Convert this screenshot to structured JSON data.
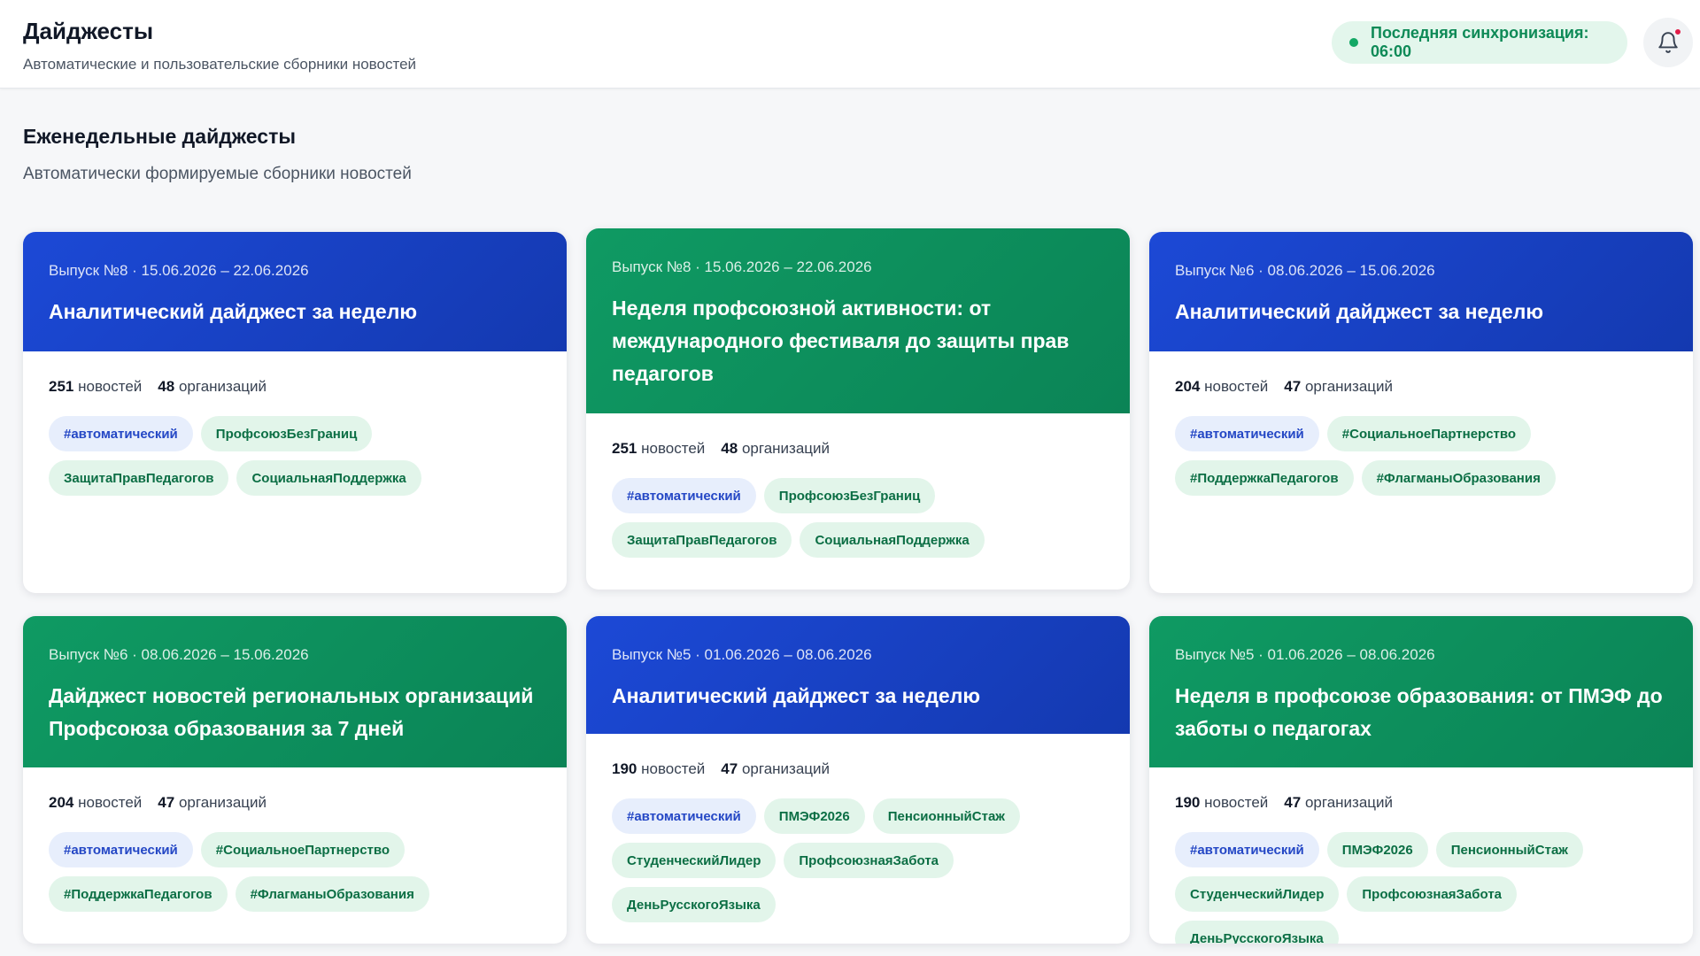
{
  "header": {
    "title": "Дайджесты",
    "subtitle": "Автоматические и пользовательские сборники новостей",
    "sync_status": "Последняя синхронизация: 06:00"
  },
  "section": {
    "title": "Еженедельные дайджесты",
    "subtitle": "Автоматически формируемые сборники новостей"
  },
  "labels": {
    "news": "новостей",
    "orgs": "организаций"
  },
  "colors": {
    "blue_header": "#1c49d6",
    "green_header": "#0f9a63",
    "sync_bg": "#e3f6ec",
    "sync_text": "#0e8a57",
    "tag_green_bg": "#e2f5ea",
    "tag_blue_bg": "#e7eefc",
    "notification_badge": "#e11d48"
  },
  "icons": {
    "sync": "status-dot-icon",
    "notifications": "bell-icon"
  },
  "cards": [
    {
      "theme": "blue",
      "meta": "Выпуск №8 · 15.06.2026 – 22.06.2026",
      "title": "Аналитический дайджест за неделю",
      "news_count": "251",
      "org_count": "48",
      "tags": [
        "#автоматический",
        "ПрофсоюзБезГраниц",
        "ЗащитаПравПедагогов",
        "СоциальнаяПоддержка"
      ]
    },
    {
      "theme": "green",
      "meta": "Выпуск №8 · 15.06.2026 – 22.06.2026",
      "title": "Неделя профсоюзной активности: от международного фестиваля до защиты прав педагогов",
      "news_count": "251",
      "org_count": "48",
      "tags": [
        "#автоматический",
        "ПрофсоюзБезГраниц",
        "ЗащитаПравПедагогов",
        "СоциальнаяПоддержка"
      ]
    },
    {
      "theme": "blue",
      "meta": "Выпуск №6 · 08.06.2026 – 15.06.2026",
      "title": "Аналитический дайджест за неделю",
      "news_count": "204",
      "org_count": "47",
      "tags": [
        "#автоматический",
        "#СоциальноеПартнерство",
        "#ПоддержкаПедагогов",
        "#ФлагманыОбразования"
      ]
    },
    {
      "theme": "green",
      "meta": "Выпуск №6 · 08.06.2026 – 15.06.2026",
      "title": "Дайджест новостей региональных организаций Профсоюза образования за 7 дней",
      "news_count": "204",
      "org_count": "47",
      "tags": [
        "#автоматический",
        "#СоциальноеПартнерство",
        "#ПоддержкаПедагогов",
        "#ФлагманыОбразования"
      ]
    },
    {
      "theme": "blue",
      "meta": "Выпуск №5 · 01.06.2026 – 08.06.2026",
      "title": "Аналитический дайджест за неделю",
      "news_count": "190",
      "org_count": "47",
      "tags": [
        "#автоматический",
        "ПМЭФ2026",
        "ПенсионныйСтаж",
        "СтуденческийЛидер",
        "ПрофсоюзнаяЗабота",
        "ДеньРусскогоЯзыка"
      ]
    },
    {
      "theme": "green",
      "meta": "Выпуск №5 · 01.06.2026 – 08.06.2026",
      "title": "Неделя в профсоюзе образования: от ПМЭФ до заботы о педагогах",
      "news_count": "190",
      "org_count": "47",
      "tags": [
        "#автоматический",
        "ПМЭФ2026",
        "ПенсионныйСтаж",
        "СтуденческийЛидер",
        "ПрофсоюзнаяЗабота",
        "ДеньРусскогоЯзыка"
      ]
    }
  ]
}
